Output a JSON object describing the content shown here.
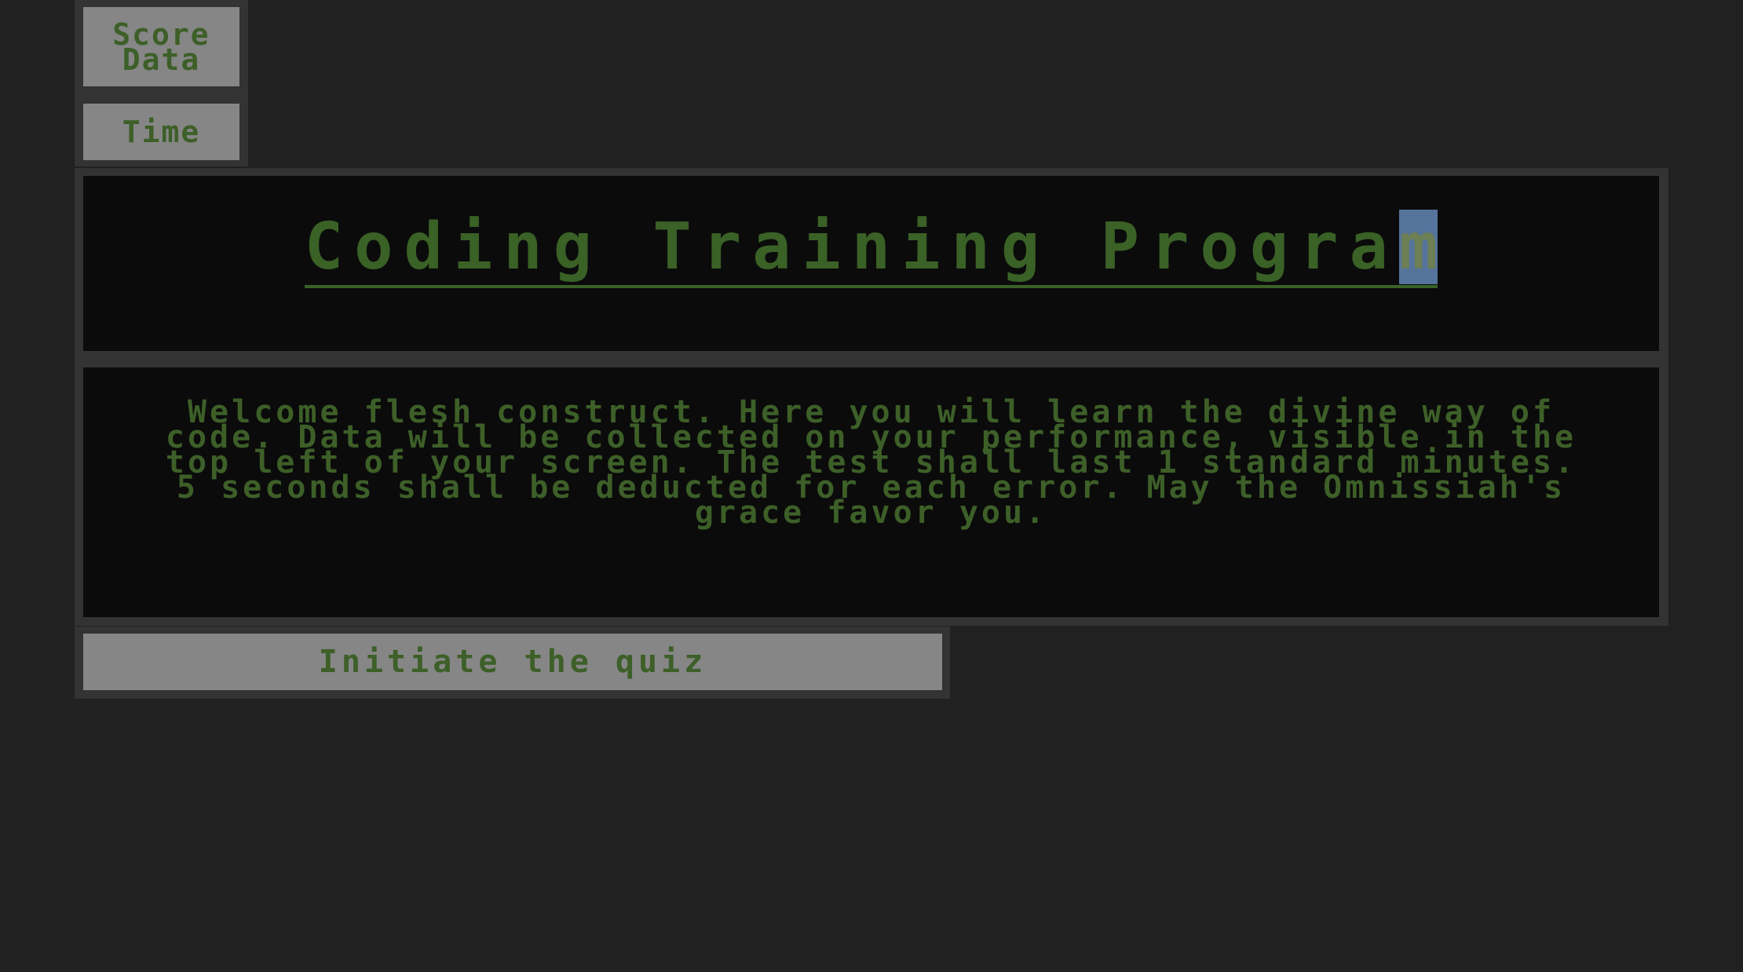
{
  "stats": {
    "score_label": "Score Data",
    "time_label": "Time"
  },
  "header": {
    "title_main": "Coding Training Progra",
    "title_selected": "m"
  },
  "intro": {
    "text": "Welcome flesh construct. Here you will learn the divine way of code. Data will be collected on your performance, visible in the top left of your screen. The test shall last 1 standard minutes. 5 seconds shall be deducted for each error. May the Omnissiah's grace favor you."
  },
  "actions": {
    "start_label": "Initiate the quiz"
  },
  "colors": {
    "background": "#202120",
    "panel": "#0b0b0b",
    "frame": "#323332",
    "text_green": "#3d5f28",
    "button_gray": "#868686",
    "selection": "#55749c"
  }
}
